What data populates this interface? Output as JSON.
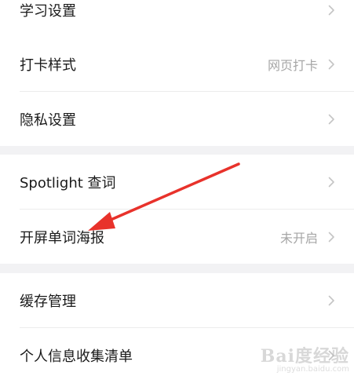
{
  "settings": {
    "group1": [
      {
        "label": "学习设置",
        "value": ""
      },
      {
        "label": "打卡样式",
        "value": "网页打卡"
      },
      {
        "label": "隐私设置",
        "value": ""
      }
    ],
    "group2": [
      {
        "label": "Spotlight 查词",
        "value": ""
      },
      {
        "label": "开屏单词海报",
        "value": "未开启"
      }
    ],
    "group3": [
      {
        "label": "缓存管理",
        "value": ""
      },
      {
        "label": "个人信息收集清单",
        "value": ""
      }
    ]
  },
  "icons": {
    "chevron": "chevron-right-icon",
    "annotation": "red-arrow-annotation"
  },
  "colors": {
    "background": "#f2f2f4",
    "row": "#ffffff",
    "text": "#1a1a1a",
    "secondary_text": "#a6a6a6",
    "chevron": "#c4c4c4",
    "annotation_arrow": "#e8322b"
  },
  "watermark": {
    "logo": "Bai度经验",
    "url": "jingyan.baidu.com"
  }
}
